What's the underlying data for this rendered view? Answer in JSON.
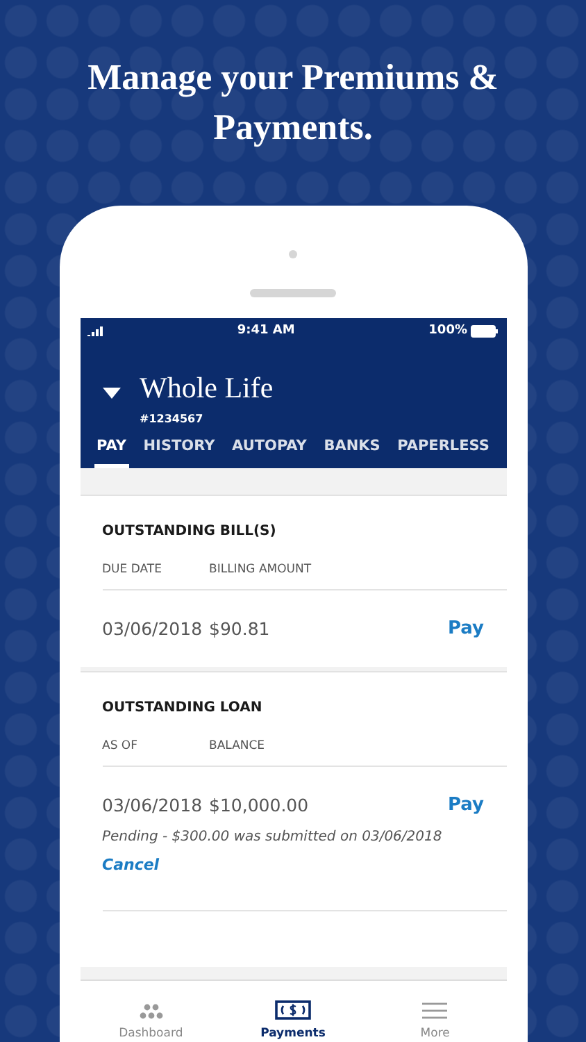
{
  "headline": "Manage your Premiums & Payments.",
  "status_bar": {
    "time": "9:41 AM",
    "battery": "100%"
  },
  "policy": {
    "name": "Whole Life",
    "number": "#1234567"
  },
  "tabs": [
    {
      "label": "PAY",
      "selected": true
    },
    {
      "label": "HISTORY",
      "selected": false
    },
    {
      "label": "AUTOPAY",
      "selected": false
    },
    {
      "label": "BANKS",
      "selected": false
    },
    {
      "label": "PAPERLESS",
      "selected": false
    }
  ],
  "sections": [
    {
      "title": "OUTSTANDING BILL(S)",
      "columns": [
        "DUE DATE",
        "BILLING AMOUNT"
      ],
      "row": {
        "date": "03/06/2018",
        "amount": "$90.81",
        "action": "Pay"
      }
    },
    {
      "title": "OUTSTANDING LOAN",
      "columns": [
        "AS OF",
        "BALANCE"
      ],
      "row": {
        "date": "03/06/2018",
        "amount": "$10,000.00",
        "action": "Pay"
      },
      "note": "Pending - $300.00 was submitted on 03/06/2018",
      "note_action": "Cancel"
    }
  ],
  "nav": [
    {
      "kind": "dashboard",
      "label": "Dashboard",
      "selected": false
    },
    {
      "kind": "payments",
      "label": "Payments",
      "selected": true
    },
    {
      "kind": "more",
      "label": "More",
      "selected": false
    }
  ]
}
